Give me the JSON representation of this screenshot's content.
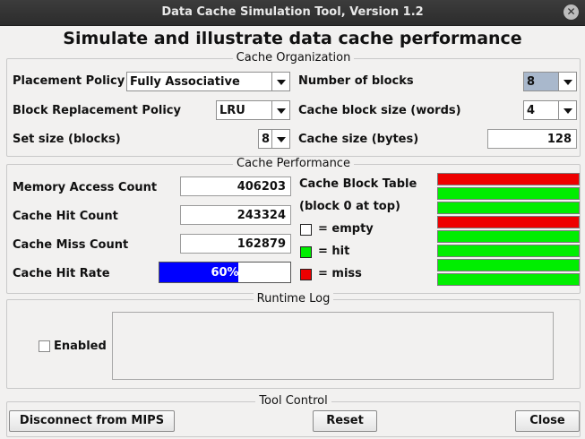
{
  "window": {
    "title": "Data Cache Simulation Tool, Version 1.2",
    "close_symbol": "✕"
  },
  "heading": "Simulate and illustrate data cache performance",
  "organization": {
    "title": "Cache Organization",
    "placement_label": "Placement Policy",
    "placement_value": "Fully Associative",
    "replacement_label": "Block Replacement Policy",
    "replacement_value": "LRU",
    "set_size_label": "Set size (blocks)",
    "set_size_value": "8",
    "num_blocks_label": "Number of blocks",
    "num_blocks_value": "8",
    "block_size_label": "Cache block size (words)",
    "block_size_value": "4",
    "cache_size_label": "Cache size (bytes)",
    "cache_size_value": "128"
  },
  "performance": {
    "title": "Cache Performance",
    "access_label": "Memory Access Count",
    "access_value": "406203",
    "hit_label": "Cache Hit Count",
    "hit_value": "243324",
    "miss_label": "Cache Miss Count",
    "miss_value": "162879",
    "rate_label": "Cache Hit Rate",
    "rate_text": "60%",
    "rate_fraction": 0.6,
    "table_title": "Cache Block Table",
    "table_subtitle": "(block 0 at top)",
    "legend_empty": "= empty",
    "legend_hit": "= hit",
    "legend_miss": "= miss",
    "colors": {
      "empty": "#ffffff",
      "hit": "#00ee00",
      "miss": "#ee0000"
    },
    "blocks": [
      "miss",
      "hit",
      "hit",
      "miss",
      "hit",
      "hit",
      "hit",
      "hit"
    ]
  },
  "log": {
    "title": "Runtime Log",
    "enabled_label": "Enabled",
    "enabled": false
  },
  "control": {
    "title": "Tool Control",
    "disconnect_label": "Disconnect from MIPS",
    "reset_label": "Reset",
    "close_label": "Close"
  }
}
